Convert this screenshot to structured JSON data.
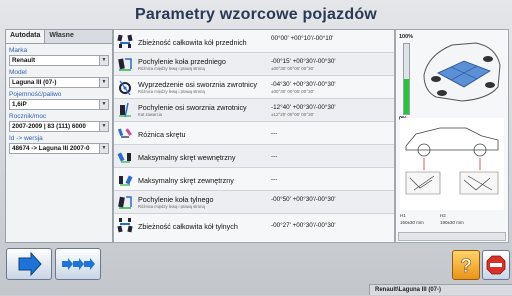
{
  "title": "Parametry wzorcowe pojazdów",
  "left": {
    "tabs": [
      "Autodata",
      "Własne"
    ],
    "fields": [
      {
        "label": "Marka",
        "value": "Renault"
      },
      {
        "label": "Model",
        "value": "Laguna III (07-)"
      },
      {
        "label": "Pojemność/paliwo",
        "value": "1,6iP"
      },
      {
        "label": "Rocznik/moc",
        "value": "2007-2009 | 83 (111) 6000"
      },
      {
        "label": "Id -> wersja",
        "value": "48674 -> Laguna III 2007-0"
      }
    ]
  },
  "params": [
    {
      "name": "Zbieżność całkowita kół przednich",
      "sub": "",
      "value": "00°00' +00°10'/-00°10'",
      "value2": ""
    },
    {
      "name": "Pochylenie koła przedniego",
      "sub": "Różnica między lewą i prawą stroną",
      "value": "-00°15' +00°30'/-00°30'",
      "value2": "±00°30' 00°00' 00°30'"
    },
    {
      "name": "Wyprzedzenie osi sworznia zwrotnicy",
      "sub": "Różnica między lewą i prawą stroną",
      "value": "-04°30' +00°30'/-00°30'",
      "value2": "±00°30' 00°00' 00°30'"
    },
    {
      "name": "Pochylenie osi sworznia zwrotnicy",
      "sub": "Kat zawarcia",
      "value": "-12°40' +00°30'/-00°30'",
      "value2": "±12°20' 00°00' 00°30'"
    },
    {
      "name": "Różnica skrętu",
      "sub": "",
      "value": "---",
      "value2": ""
    },
    {
      "name": "Maksymalny skręt wewnętrzny",
      "sub": "",
      "value": "---",
      "value2": ""
    },
    {
      "name": "Maksymalny skręt zewnętrzny",
      "sub": "",
      "value": "---",
      "value2": ""
    },
    {
      "name": "Pochylenie koła tylnego",
      "sub": "Różnica między lewą i prawą stroną",
      "value": "-00°50' +00°30'/-00°30'",
      "value2": ""
    },
    {
      "name": "Zbieżność całkowita kół tylnych",
      "sub": "",
      "value": "-00°27' +00°30'/-00°30'",
      "value2": ""
    }
  ],
  "right": {
    "gauge_top_label": "100%",
    "gauge_bottom_label": "0%",
    "gauge_level": 0.5,
    "h1_label": "H1",
    "h2_label": "H2",
    "h1_value": "160±30 mm",
    "h2_value": "190±30 mm"
  },
  "status": "Renault\\Laguna III (07-)",
  "colors": {
    "accent": "#2f5fb0",
    "gauge": "#27c43a",
    "help": "#f0a020",
    "exit": "#d9302a"
  }
}
